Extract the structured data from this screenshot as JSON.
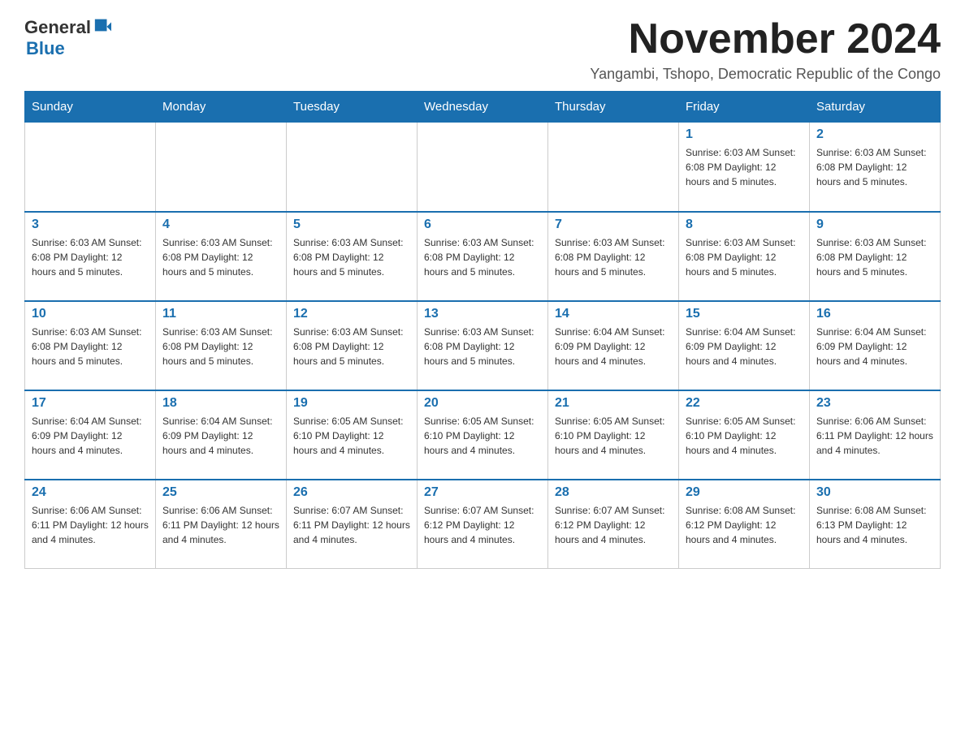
{
  "header": {
    "logo_general": "General",
    "logo_blue": "Blue",
    "title": "November 2024",
    "subtitle": "Yangambi, Tshopo, Democratic Republic of the Congo"
  },
  "weekdays": [
    "Sunday",
    "Monday",
    "Tuesday",
    "Wednesday",
    "Thursday",
    "Friday",
    "Saturday"
  ],
  "weeks": [
    [
      {
        "day": "",
        "info": ""
      },
      {
        "day": "",
        "info": ""
      },
      {
        "day": "",
        "info": ""
      },
      {
        "day": "",
        "info": ""
      },
      {
        "day": "",
        "info": ""
      },
      {
        "day": "1",
        "info": "Sunrise: 6:03 AM\nSunset: 6:08 PM\nDaylight: 12 hours and 5 minutes."
      },
      {
        "day": "2",
        "info": "Sunrise: 6:03 AM\nSunset: 6:08 PM\nDaylight: 12 hours and 5 minutes."
      }
    ],
    [
      {
        "day": "3",
        "info": "Sunrise: 6:03 AM\nSunset: 6:08 PM\nDaylight: 12 hours and 5 minutes."
      },
      {
        "day": "4",
        "info": "Sunrise: 6:03 AM\nSunset: 6:08 PM\nDaylight: 12 hours and 5 minutes."
      },
      {
        "day": "5",
        "info": "Sunrise: 6:03 AM\nSunset: 6:08 PM\nDaylight: 12 hours and 5 minutes."
      },
      {
        "day": "6",
        "info": "Sunrise: 6:03 AM\nSunset: 6:08 PM\nDaylight: 12 hours and 5 minutes."
      },
      {
        "day": "7",
        "info": "Sunrise: 6:03 AM\nSunset: 6:08 PM\nDaylight: 12 hours and 5 minutes."
      },
      {
        "day": "8",
        "info": "Sunrise: 6:03 AM\nSunset: 6:08 PM\nDaylight: 12 hours and 5 minutes."
      },
      {
        "day": "9",
        "info": "Sunrise: 6:03 AM\nSunset: 6:08 PM\nDaylight: 12 hours and 5 minutes."
      }
    ],
    [
      {
        "day": "10",
        "info": "Sunrise: 6:03 AM\nSunset: 6:08 PM\nDaylight: 12 hours and 5 minutes."
      },
      {
        "day": "11",
        "info": "Sunrise: 6:03 AM\nSunset: 6:08 PM\nDaylight: 12 hours and 5 minutes."
      },
      {
        "day": "12",
        "info": "Sunrise: 6:03 AM\nSunset: 6:08 PM\nDaylight: 12 hours and 5 minutes."
      },
      {
        "day": "13",
        "info": "Sunrise: 6:03 AM\nSunset: 6:08 PM\nDaylight: 12 hours and 5 minutes."
      },
      {
        "day": "14",
        "info": "Sunrise: 6:04 AM\nSunset: 6:09 PM\nDaylight: 12 hours and 4 minutes."
      },
      {
        "day": "15",
        "info": "Sunrise: 6:04 AM\nSunset: 6:09 PM\nDaylight: 12 hours and 4 minutes."
      },
      {
        "day": "16",
        "info": "Sunrise: 6:04 AM\nSunset: 6:09 PM\nDaylight: 12 hours and 4 minutes."
      }
    ],
    [
      {
        "day": "17",
        "info": "Sunrise: 6:04 AM\nSunset: 6:09 PM\nDaylight: 12 hours and 4 minutes."
      },
      {
        "day": "18",
        "info": "Sunrise: 6:04 AM\nSunset: 6:09 PM\nDaylight: 12 hours and 4 minutes."
      },
      {
        "day": "19",
        "info": "Sunrise: 6:05 AM\nSunset: 6:10 PM\nDaylight: 12 hours and 4 minutes."
      },
      {
        "day": "20",
        "info": "Sunrise: 6:05 AM\nSunset: 6:10 PM\nDaylight: 12 hours and 4 minutes."
      },
      {
        "day": "21",
        "info": "Sunrise: 6:05 AM\nSunset: 6:10 PM\nDaylight: 12 hours and 4 minutes."
      },
      {
        "day": "22",
        "info": "Sunrise: 6:05 AM\nSunset: 6:10 PM\nDaylight: 12 hours and 4 minutes."
      },
      {
        "day": "23",
        "info": "Sunrise: 6:06 AM\nSunset: 6:11 PM\nDaylight: 12 hours and 4 minutes."
      }
    ],
    [
      {
        "day": "24",
        "info": "Sunrise: 6:06 AM\nSunset: 6:11 PM\nDaylight: 12 hours and 4 minutes."
      },
      {
        "day": "25",
        "info": "Sunrise: 6:06 AM\nSunset: 6:11 PM\nDaylight: 12 hours and 4 minutes."
      },
      {
        "day": "26",
        "info": "Sunrise: 6:07 AM\nSunset: 6:11 PM\nDaylight: 12 hours and 4 minutes."
      },
      {
        "day": "27",
        "info": "Sunrise: 6:07 AM\nSunset: 6:12 PM\nDaylight: 12 hours and 4 minutes."
      },
      {
        "day": "28",
        "info": "Sunrise: 6:07 AM\nSunset: 6:12 PM\nDaylight: 12 hours and 4 minutes."
      },
      {
        "day": "29",
        "info": "Sunrise: 6:08 AM\nSunset: 6:12 PM\nDaylight: 12 hours and 4 minutes."
      },
      {
        "day": "30",
        "info": "Sunrise: 6:08 AM\nSunset: 6:13 PM\nDaylight: 12 hours and 4 minutes."
      }
    ]
  ]
}
